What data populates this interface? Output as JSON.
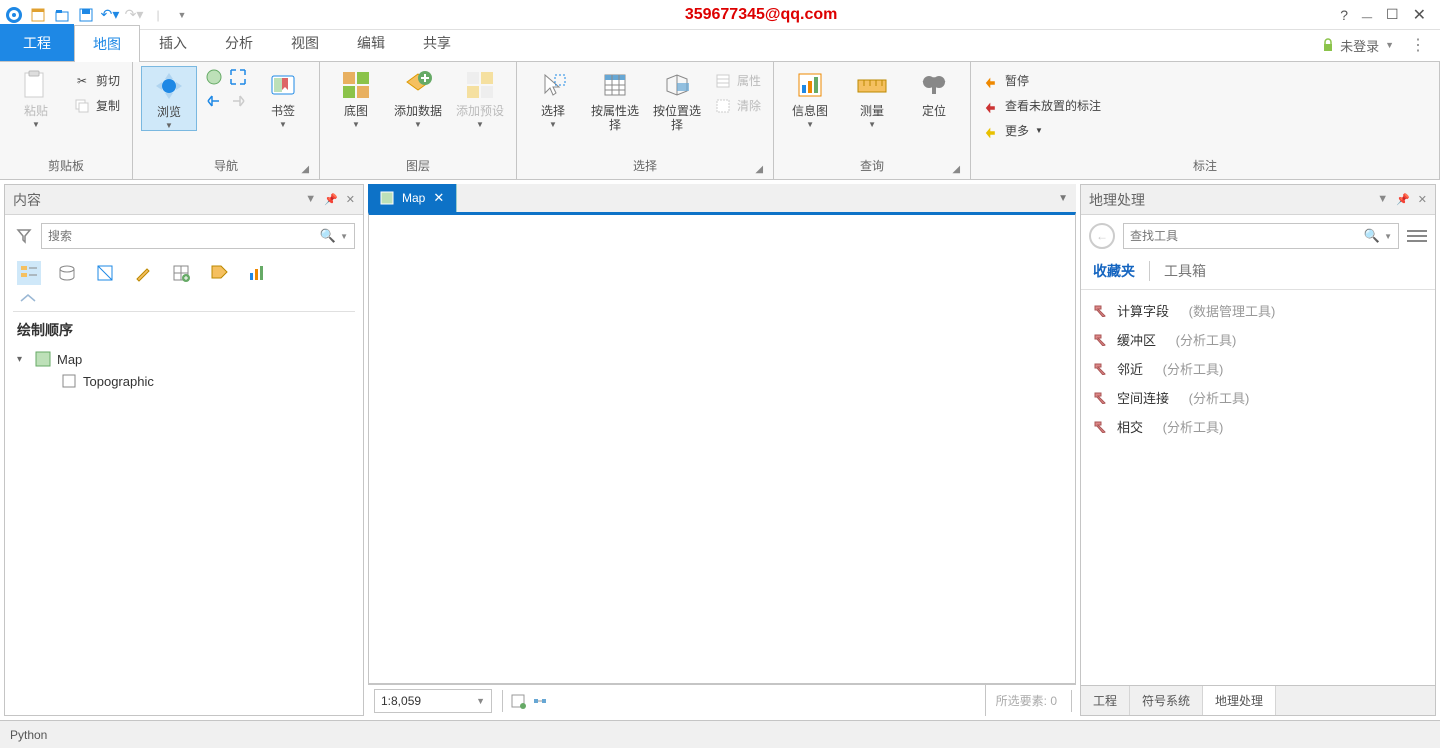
{
  "titlebar": {
    "watermark": "359677345@qq.com"
  },
  "login": {
    "label": "未登录"
  },
  "tabs": {
    "project": "工程",
    "map": "地图",
    "insert": "插入",
    "analyze": "分析",
    "view": "视图",
    "edit": "编辑",
    "share": "共享"
  },
  "ribbon": {
    "clipboard": {
      "paste": "粘贴",
      "cut": "剪切",
      "copy": "复制",
      "group": "剪贴板"
    },
    "nav": {
      "explore": "浏览",
      "bookmark": "书签",
      "group": "导航"
    },
    "layer": {
      "basemap": "底图",
      "add_data": "添加数据",
      "add_preset": "添加预设",
      "group": "图层"
    },
    "select": {
      "select": "选择",
      "by_attr": "按属性选择",
      "by_loc": "按位置选择",
      "attrs": "属性",
      "clear": "清除",
      "group": "选择"
    },
    "query": {
      "infographics": "信息图",
      "measure": "测量",
      "locate": "定位",
      "group": "查询"
    },
    "label": {
      "pause": "暂停",
      "unplaced": "查看未放置的标注",
      "more": "更多",
      "group": "标注"
    }
  },
  "contents": {
    "title": "内容",
    "search_ph": "搜索",
    "section": "绘制顺序",
    "map_node": "Map",
    "layer_node": "Topographic"
  },
  "map": {
    "tab": "Map",
    "scale": "1:8,059",
    "selected_label": "所选要素:",
    "selected_count": "0"
  },
  "gp": {
    "title": "地理处理",
    "search_ph": "查找工具",
    "tab_fav": "收藏夹",
    "tab_toolbox": "工具箱",
    "tools": [
      {
        "name": "计算字段",
        "cat": "(数据管理工具)"
      },
      {
        "name": "缓冲区",
        "cat": "(分析工具)"
      },
      {
        "name": "邻近",
        "cat": "(分析工具)"
      },
      {
        "name": "空间连接",
        "cat": "(分析工具)"
      },
      {
        "name": "相交",
        "cat": "(分析工具)"
      }
    ],
    "bottom_tabs": {
      "project": "工程",
      "symbology": "符号系统",
      "gp": "地理处理"
    }
  },
  "status": {
    "python": "Python"
  }
}
